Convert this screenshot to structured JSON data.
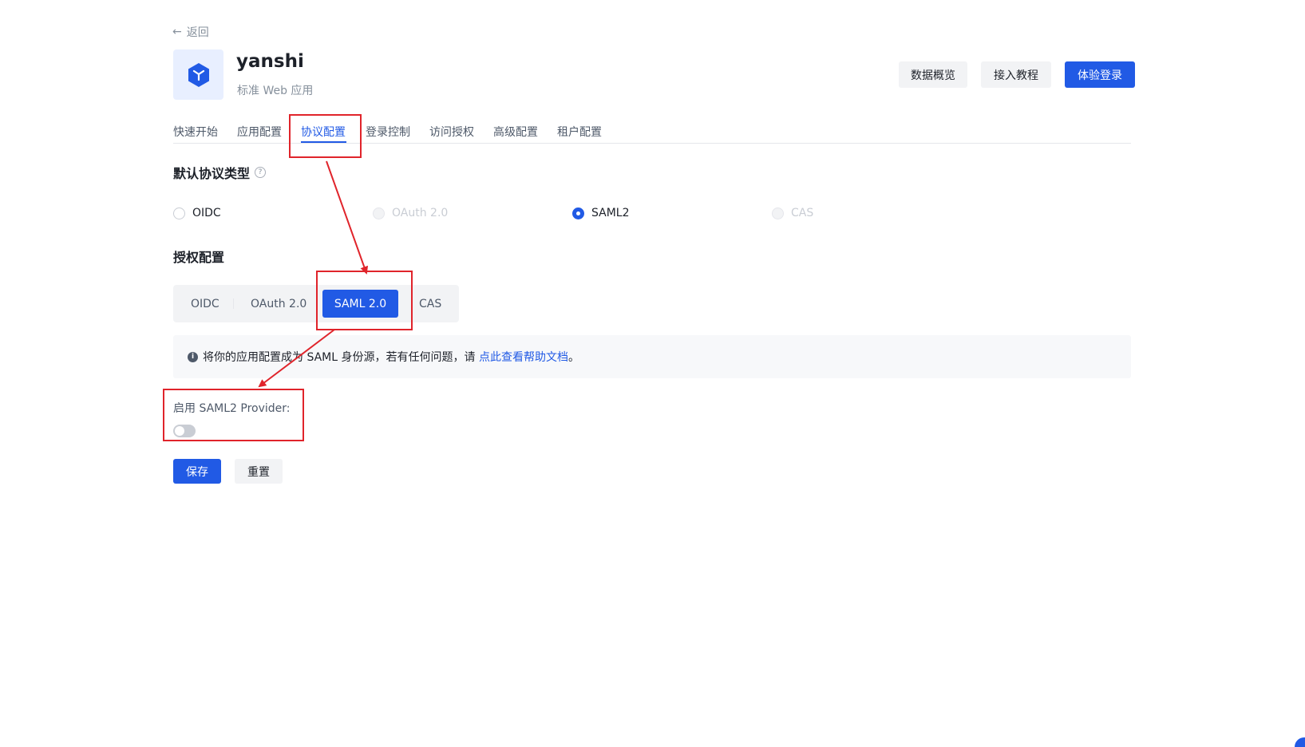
{
  "back": {
    "label": "返回"
  },
  "app": {
    "name": "yanshi",
    "type": "标准 Web 应用"
  },
  "header_buttons": {
    "overview": "数据概览",
    "tutorial": "接入教程",
    "try_login": "体验登录"
  },
  "tabs": [
    {
      "label": "快速开始",
      "active": false
    },
    {
      "label": "应用配置",
      "active": false
    },
    {
      "label": "协议配置",
      "active": true
    },
    {
      "label": "登录控制",
      "active": false
    },
    {
      "label": "访问授权",
      "active": false
    },
    {
      "label": "高级配置",
      "active": false
    },
    {
      "label": "租户配置",
      "active": false
    }
  ],
  "default_protocol": {
    "title": "默认协议类型",
    "options": [
      {
        "label": "OIDC",
        "checked": false,
        "disabled": false
      },
      {
        "label": "OAuth 2.0",
        "checked": false,
        "disabled": true
      },
      {
        "label": "SAML2",
        "checked": true,
        "disabled": false
      },
      {
        "label": "CAS",
        "checked": false,
        "disabled": true
      }
    ]
  },
  "auth_config": {
    "title": "授权配置",
    "segments": [
      {
        "label": "OIDC",
        "active": false
      },
      {
        "label": "OAuth 2.0",
        "active": false
      },
      {
        "label": "SAML 2.0",
        "active": true
      },
      {
        "label": "CAS",
        "active": false
      }
    ]
  },
  "info": {
    "text": "将你的应用配置成为 SAML 身份源，若有任何问题，请 ",
    "link": "点此查看帮助文档",
    "suffix": "。"
  },
  "provider": {
    "label": "启用 SAML2 Provider:",
    "enabled": false
  },
  "actions": {
    "save": "保存",
    "reset": "重置"
  },
  "colors": {
    "primary": "#215ae5",
    "annotation": "#e0242b"
  }
}
